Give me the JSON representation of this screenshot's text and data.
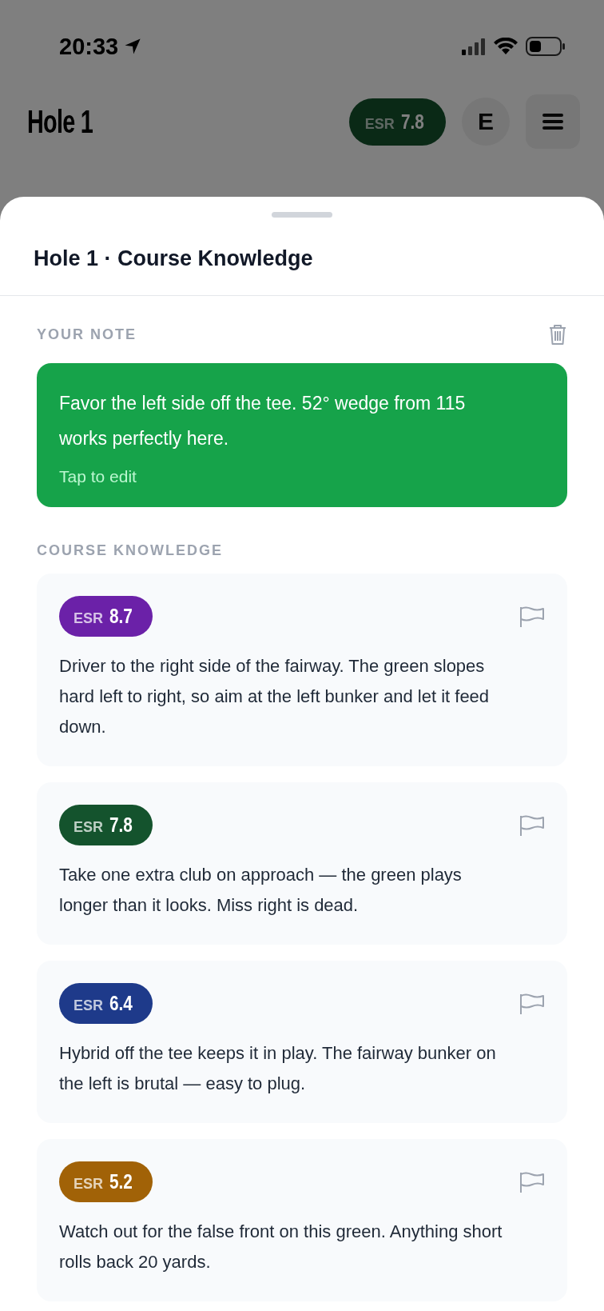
{
  "status_bar": {
    "time": "20:33"
  },
  "header": {
    "title": "Hole 1",
    "esr_badge": {
      "label": "ESR",
      "score": "7.8"
    },
    "player_initial": "E"
  },
  "sheet": {
    "title": "Hole 1 · Course Knowledge",
    "note_section": {
      "heading": "YOUR NOTE",
      "note": "Favor the left side off the tee. 52° wedge from 115 works perfectly here.",
      "hint": "Tap to edit"
    },
    "knowledge_section": {
      "heading": "COURSE KNOWLEDGE",
      "tips": [
        {
          "label": "ESR",
          "score": "8.7",
          "color": "#6b21a8",
          "text": "Driver to the right side of the fairway. The green slopes hard left to right, so aim at the left bunker and let it feed down."
        },
        {
          "label": "ESR",
          "score": "7.8",
          "color": "#14532d",
          "text": "Take one extra club on approach — the green plays longer than it looks. Miss right is dead."
        },
        {
          "label": "ESR",
          "score": "6.4",
          "color": "#1e3a8a",
          "text": "Hybrid off the tee keeps it in play. The fairway bunker on the left is brutal — easy to plug."
        },
        {
          "label": "ESR",
          "score": "5.2",
          "color": "#a16207",
          "text": "Watch out for the false front on this green. Anything short rolls back 20 yards."
        }
      ]
    }
  }
}
